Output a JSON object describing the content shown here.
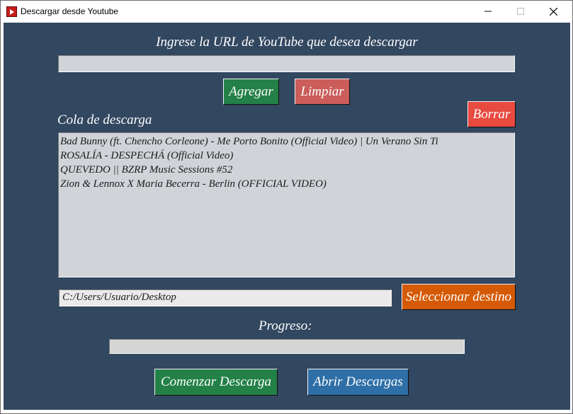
{
  "window": {
    "title": "Descargar desde Youtube"
  },
  "url_section": {
    "label": "Ingrese la URL de YouTube que desea descargar",
    "url_value": ""
  },
  "buttons": {
    "add": "Agregar",
    "clear": "Limpiar",
    "delete": "Borrar",
    "select_destination": "Seleccionar destino",
    "start_download": "Comenzar Descarga",
    "open_downloads": "Abrir Descargas"
  },
  "queue": {
    "label": "Cola de descarga",
    "items": [
      "Bad Bunny (ft. Chencho Corleone) - Me Porto Bonito (Official Video) | Un Verano Sin Ti",
      "ROSALÍA - DESPECHÁ (Official Video)",
      "QUEVEDO || BZRP Music Sessions #52",
      "Zion & Lennox X Maria Becerra - Berlin (OFFICIAL VIDEO)"
    ]
  },
  "destination": {
    "path": "C:/Users/Usuario/Desktop"
  },
  "progress": {
    "label": "Progreso:",
    "value": 0
  },
  "colors": {
    "background": "#324760",
    "green": "#238148",
    "red": "#cb5d5a",
    "bright_red": "#e84a3f",
    "orange": "#d55a06",
    "blue": "#2f6fa7"
  },
  "icons": {
    "app": "youtube-icon",
    "minimize": "minimize-icon",
    "maximize": "maximize-icon",
    "close": "close-icon"
  }
}
